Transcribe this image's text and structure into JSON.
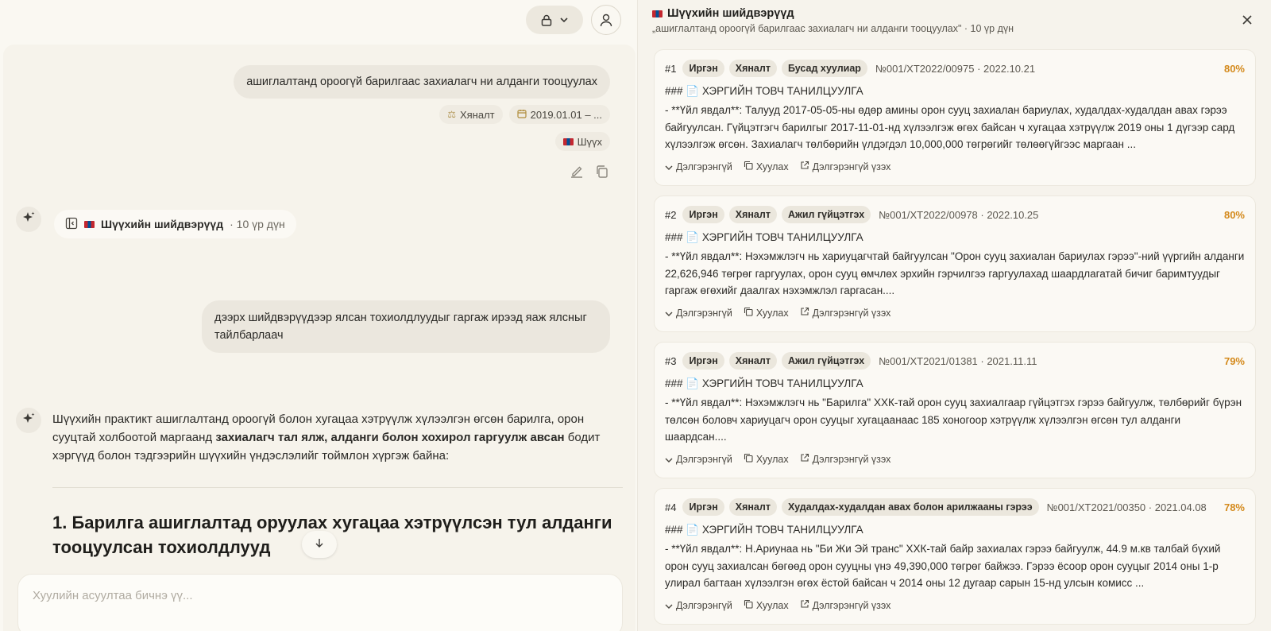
{
  "topbar": {
    "lock_icon": "lock-icon",
    "chevron_icon": "chevron-down-icon",
    "user_icon": "user-icon"
  },
  "chat": {
    "user_message_1": "ашиглалтанд ороогүй барилгаас захиалагч ни алданги тооцуулах",
    "filter_chips": [
      "Хяналт",
      "2019.01.01 – ..."
    ],
    "court_chip": "Шүүх",
    "sources_pill": {
      "label": "Шүүхийн шийдвэрүүд",
      "meta": "· 10 үр дүн"
    },
    "user_message_2": "дээрх шийдвэрүүдээр ялсан тохиолдлуудыг гаргаж ирээд яаж ялсныг тайлбарлаач",
    "answer_prefix": "Шүүхийн практикт ашиглалтанд ороогүй болон хугацаа хэтрүүлж хүлээлгэн өгсөн барилга, орон сууцтай холбоотой маргаанд ",
    "answer_bold": "захиалагч тал ялж, алданги болон хохирол гаргуулж авсан",
    "answer_suffix": " бодит хэргүүд болон тэдгээрийн шүүхийн үндэслэлийг тоймлон хүргэж байна:",
    "section_heading": "1. Барилга ашиглалтад оруулах хугацаа хэтрүүлсэн тул алданги тооцуулсан тохиолдлууд",
    "composer_placeholder": "Хуулийн асуултаа бичнэ үү..."
  },
  "panel": {
    "title": "Шүүхийн шийдвэрүүд",
    "subtitle": "„ашиглалтанд ороогүй барилгаас захиалагч ни алданги тооцуулах\" · 10 үр дүн",
    "results": [
      {
        "num": "#1",
        "tags": [
          "Иргэн",
          "Хяналт",
          "Бусад хуулиар"
        ],
        "ref": "№001/ХТ2022/00975 · 2022.10.21",
        "score": "80%",
        "heading": "### 📄 ХЭРГИЙН ТОВЧ ТАНИЛЦУУЛГА",
        "body": "- **Үйл явдал**: Талууд 2017-05-05-ны өдөр амины орон сууц захиалан бариулах, худалдах-худалдан авах гэрээ байгуулсан. Гүйцэтгэгч барилгыг 2017-11-01-нд хүлээлгэж өгөх байсан ч хугацаа хэтрүүлж 2019 оны 1 дүгээр сард хүлээлгэж өгсөн. Захиалагч төлбөрийн үлдэгдэл 10,000,000 төгрөгийг төлөөгүйгээс маргаан ..."
      },
      {
        "num": "#2",
        "tags": [
          "Иргэн",
          "Хяналт",
          "Ажил гүйцэтгэх"
        ],
        "ref": "№001/ХТ2022/00978 · 2022.10.25",
        "score": "80%",
        "heading": "### 📄 ХЭРГИЙН ТОВЧ ТАНИЛЦУУЛГА",
        "body": "- **Үйл явдал**: Нэхэмжлэгч нь хариуцагчтай байгуулсан \"Орон сууц захиалан бариулах гэрээ\"-ний үүргийн алданги 22,626,946 төгрөг гаргуулах, орон сууц өмчлөх эрхийн гэрчилгээ гаргуулахад шаардлагатай бичиг баримтуудыг гаргаж өгөхийг даалгах нэхэмжлэл гаргасан...."
      },
      {
        "num": "#3",
        "tags": [
          "Иргэн",
          "Хяналт",
          "Ажил гүйцэтгэх"
        ],
        "ref": "№001/ХТ2021/01381 · 2021.11.11",
        "score": "79%",
        "heading": "### 📄 ХЭРГИЙН ТОВЧ ТАНИЛЦУУЛГА",
        "body": "- **Үйл явдал**: Нэхэмжлэгч нь \"Барилга\" ХХК-тай орон сууц захиалгаар гүйцэтгэх гэрээ байгуулж, төлбөрийг бүрэн төлсөн боловч хариуцагч орон сууцыг хугацаанаас 185 хоногоор хэтрүүлж хүлээлгэн өгсөн тул алданги шаардсан...."
      },
      {
        "num": "#4",
        "tags": [
          "Иргэн",
          "Хяналт",
          "Худалдах-худалдан авах болон арилжааны гэрээ"
        ],
        "ref": "№001/ХТ2021/00350 · 2021.04.08",
        "score": "78%",
        "heading": "### 📄 ХЭРГИЙН ТОВЧ ТАНИЛЦУУЛГА",
        "body": "- **Үйл явдал**: Н.Ариунаа нь \"Би Жи Эй транс\" ХХК-тай байр захиалах гэрээ байгуулж, 44.9 м.кв талбай бүхий орон сууц захиалсан бөгөөд орон сууцны үнэ 49,390,000 төгрөг байжээ. Гэрээ ёсоор орон сууцыг 2014 оны 1-р улирал багтаан хүлээлгэн өгөх ёстой байсан ч 2014 оны 12 дугаар сарын 15-нд улсын комисс ..."
      }
    ],
    "actions": {
      "expand": "Дэлгэрэнгүй",
      "copy": "Хуулах",
      "open": "Дэлгэрэнгүй үзэх"
    }
  },
  "colors": {
    "score": "#d48a1c",
    "background": "#f6f3ec"
  }
}
